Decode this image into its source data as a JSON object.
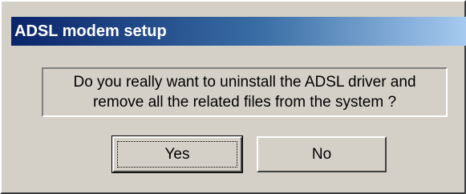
{
  "dialog": {
    "title": "ADSL modem setup",
    "message_lines": [
      "Do you really want to uninstall the ADSL driver and",
      "remove all the related files from the system ?"
    ],
    "buttons": {
      "yes_label": "Yes",
      "no_label": "No"
    }
  },
  "colors": {
    "face": "#d4d0c8",
    "title_start": "#0a246a",
    "title_end": "#a6caf0",
    "title_text": "#ffffff"
  }
}
